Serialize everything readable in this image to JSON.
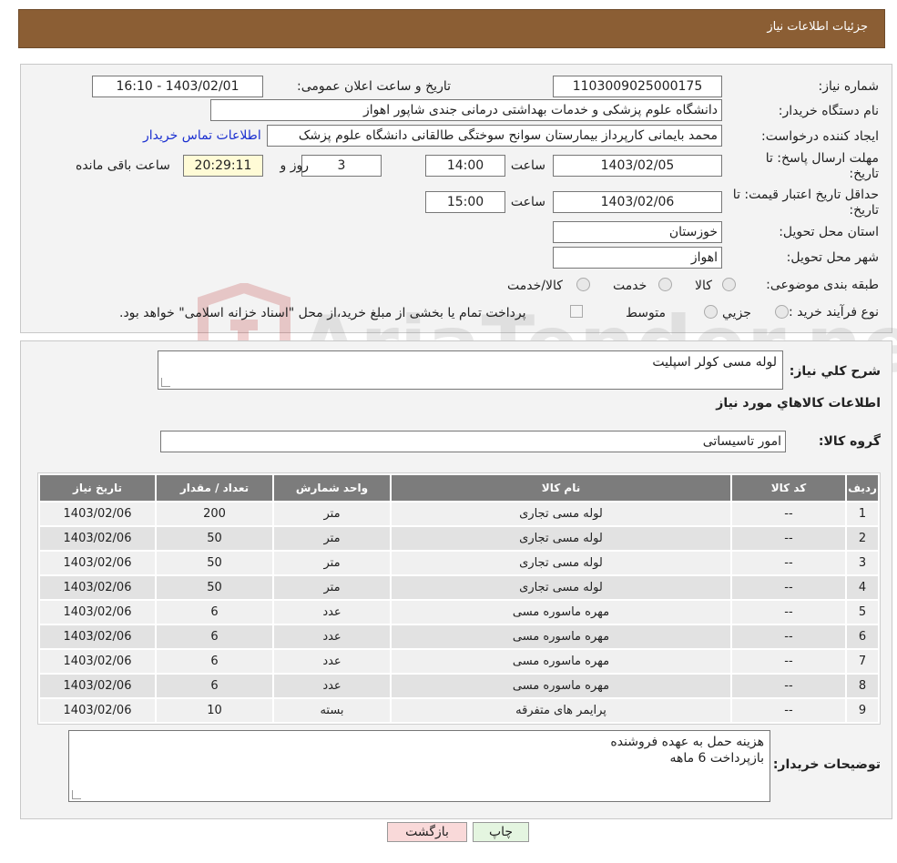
{
  "header": {
    "title": "جزئیات اطلاعات نیاز"
  },
  "labels": {
    "need_number": "شماره نیاز:",
    "announce_datetime": "تاریخ و ساعت اعلان عمومی:",
    "buyer_org": "نام دستگاه خریدار:",
    "requester": "ایجاد کننده درخواست:",
    "reply_deadline_1": "مهلت ارسال پاسخ: تا",
    "reply_deadline_2": "تاریخ:",
    "time": "ساعت",
    "days_and": "روز و",
    "time_remaining": "ساعت باقی مانده",
    "price_validity_1": "حداقل تاریخ اعتبار قیمت: تا",
    "price_validity_2": "تاریخ:",
    "province": "استان محل تحویل:",
    "city": "شهر محل تحویل:",
    "category": "طبقه بندی موضوعی:",
    "purchase_type": "نوع فرآیند خرید :",
    "general_desc": "شرح کلي نياز:",
    "goods_info": "اطلاعات کالاهاي مورد نياز",
    "goods_group": "گروه کالا:",
    "buyer_notes": "توضیحات خریدار:"
  },
  "values": {
    "need_number": "1103009025000175",
    "announce_datetime": "1403/02/01 - 16:10",
    "buyer_org": "دانشگاه علوم پزشکی و خدمات بهداشتی درمانی جندی شاپور اهواز",
    "requester": "محمد بایمانی کارپرداز بیمارستان سوانح سوختگی طالقانی دانشگاه علوم پزشک",
    "contact_link": "اطلاعات تماس خریدار",
    "reply_date": "1403/02/05",
    "reply_time": "14:00",
    "days": "3",
    "remaining": "20:29:11",
    "validity_date": "1403/02/06",
    "validity_time": "15:00",
    "province": "خوزستان",
    "city": "اهواز",
    "general_desc": "لوله مسی کولر اسپلیت",
    "goods_group": "امور تاسیساتی",
    "buyer_notes_line1": "هزینه حمل به عهده فروشنده",
    "buyer_notes_line2": "بازپرداخت 6 ماهه"
  },
  "category_options": [
    "کالا",
    "خدمت",
    "کالا/خدمت"
  ],
  "purchase_options": [
    "جزیي",
    "متوسط"
  ],
  "purchase_note": "پرداخت تمام یا بخشی از مبلغ خرید،از محل \"اسناد خزانه اسلامی\" خواهد بود.",
  "watermark_text": "AriaTender.neT",
  "table": {
    "headers": [
      "ردیف",
      "کد کالا",
      "نام کالا",
      "واحد شمارش",
      "تعداد / مقدار",
      "تاریخ نیاز"
    ],
    "rows": [
      [
        "1",
        "--",
        "لوله مسی تجاری",
        "متر",
        "200",
        "1403/02/06"
      ],
      [
        "2",
        "--",
        "لوله مسی تجاری",
        "متر",
        "50",
        "1403/02/06"
      ],
      [
        "3",
        "--",
        "لوله مسی تجاری",
        "متر",
        "50",
        "1403/02/06"
      ],
      [
        "4",
        "--",
        "لوله مسی تجاری",
        "متر",
        "50",
        "1403/02/06"
      ],
      [
        "5",
        "--",
        "مهره ماسوره مسی",
        "عدد",
        "6",
        "1403/02/06"
      ],
      [
        "6",
        "--",
        "مهره ماسوره مسی",
        "عدد",
        "6",
        "1403/02/06"
      ],
      [
        "7",
        "--",
        "مهره ماسوره مسی",
        "عدد",
        "6",
        "1403/02/06"
      ],
      [
        "8",
        "--",
        "مهره ماسوره مسی",
        "عدد",
        "6",
        "1403/02/06"
      ],
      [
        "9",
        "--",
        "پرایمر های متفرقه",
        "بسته",
        "10",
        "1403/02/06"
      ]
    ]
  },
  "buttons": {
    "print": "چاپ",
    "back": "بازگشت"
  },
  "colors": {
    "header_bg": "#8b5e34",
    "link": "#1a2fd0",
    "table_header": "#7c7c7c",
    "back_button": "#f9d9d9",
    "print_button": "#e4f5e0"
  }
}
